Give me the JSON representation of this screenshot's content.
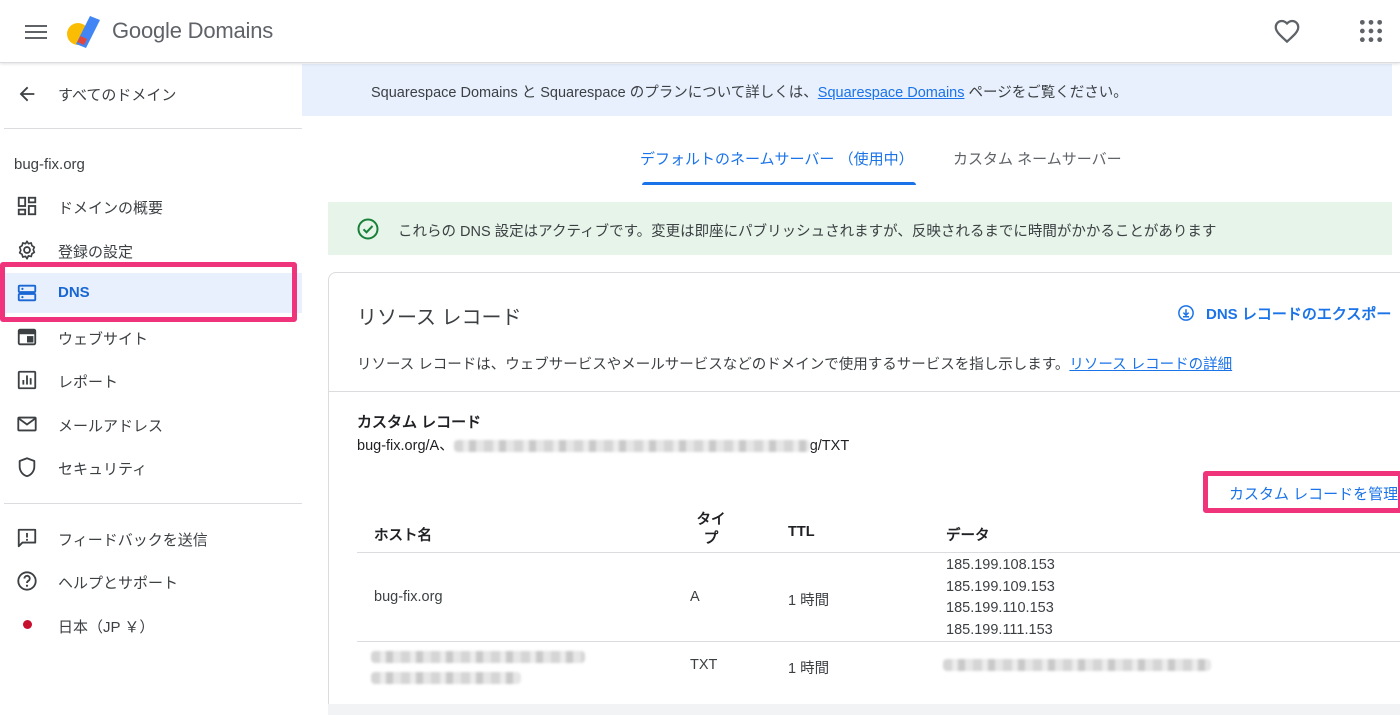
{
  "header": {
    "logo_text": "Google Domains",
    "menu_icon": "hamburger-menu-icon",
    "favorites_icon": "heart-icon",
    "apps_icon": "apps-grid-icon"
  },
  "sidebar": {
    "back_label": "すべてのドメイン",
    "domain": "bug-fix.org",
    "items": [
      {
        "label": "ドメインの概要",
        "icon": "dashboard-icon"
      },
      {
        "label": "登録の設定",
        "icon": "gear-icon"
      },
      {
        "label": "DNS",
        "icon": "dns-server-icon",
        "active": true
      },
      {
        "label": "ウェブサイト",
        "icon": "website-icon"
      },
      {
        "label": "レポート",
        "icon": "report-chart-icon"
      },
      {
        "label": "メールアドレス",
        "icon": "mail-icon"
      },
      {
        "label": "セキュリティ",
        "icon": "shield-icon"
      }
    ],
    "footer_items": [
      {
        "label": "フィードバックを送信",
        "icon": "feedback-icon"
      },
      {
        "label": "ヘルプとサポート",
        "icon": "help-icon"
      },
      {
        "label": "日本（JP ￥）",
        "icon": "japan-flag-icon"
      }
    ]
  },
  "banner": {
    "text_before": "Squarespace Domains と Squarespace のプランについて詳しくは、",
    "link": "Squarespace Domains",
    "text_after": " ページをご覧ください。"
  },
  "tabs": {
    "default_label": "デフォルトのネームサーバー （使用中）",
    "custom_label": "カスタム ネームサーバー"
  },
  "notice": {
    "text": "これらの DNS 設定はアクティブです。変更は即座にパブリッシュされますが、反映されるまでに時間がかかることがあります"
  },
  "resource_records": {
    "title": "リソース レコード",
    "export_label": "DNS レコードのエクスポー",
    "description": "リソース レコードは、ウェブサービスやメールサービスなどのドメインで使用するサービスを指し示します。",
    "details_link": "リソース レコードの詳細"
  },
  "custom_records": {
    "title": "カスタム レコード",
    "summary_prefix": "bug-fix.org/A、",
    "summary_suffix": "g/TXT",
    "manage_label": "カスタム レコードを管理"
  },
  "table": {
    "headers": {
      "host": "ホスト名",
      "type": "タイプ",
      "ttl": "TTL",
      "data": "データ"
    },
    "rows": [
      {
        "host": "bug-fix.org",
        "type": "A",
        "ttl": "1 時間",
        "data": [
          "185.199.108.153",
          "185.199.109.153",
          "185.199.110.153",
          "185.199.111.153"
        ]
      },
      {
        "host": "",
        "type": "TXT",
        "ttl": "1 時間",
        "data": []
      }
    ]
  },
  "colors": {
    "accent": "#1a73e8",
    "highlight": "#f0347c",
    "banner_bg": "#e8f0fe",
    "notice_bg": "#e6f4ea",
    "success": "#188038"
  }
}
